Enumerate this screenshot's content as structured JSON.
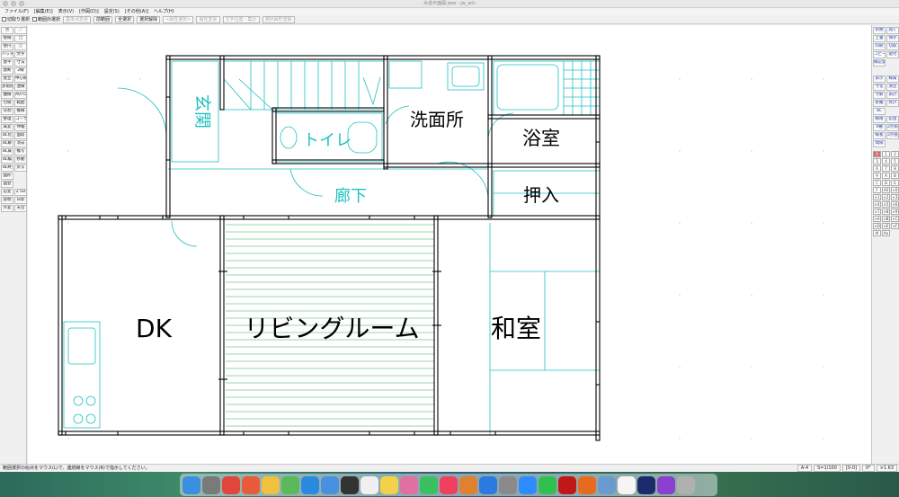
{
  "window": {
    "title": "木造平面図.jww - jw_win"
  },
  "menu": [
    "ファイル(F)",
    "[編集(E)]",
    "表示(V)",
    "[作図(D)]",
    "設定(S)",
    "[その他(A)]",
    "ヘルプ(H)"
  ],
  "toolbar": {
    "check1": "切取り選択",
    "check2": "範囲外選択",
    "btn_base": "基準点変更",
    "btn_prev": "前範囲",
    "btn_all": "全選択",
    "btn_deselect": "選択解除",
    "btn_attr": "<属性選択>",
    "btn_text": "属性変更",
    "btn_textpos": "文字位置・集計",
    "btn_select": "選択図形登録"
  },
  "left_tools": [
    "点",
    "／",
    "接線",
    "□",
    "接円",
    "○",
    "ハッチ",
    "文字",
    "建平",
    "寸法",
    "建断",
    "2線",
    "建立",
    "中心線",
    "多角形",
    "連線",
    "曲線",
    "AUTO",
    "包絡",
    "範囲",
    "分割",
    "複線",
    "整理",
    "コーナー",
    "属変",
    "伸縮",
    "BL化",
    "面取",
    "BL解",
    "消去",
    "BL属",
    "複写",
    "BL編",
    "移動",
    "BL終",
    "戻る",
    "図形",
    "",
    "図登",
    "",
    "記変",
    "2.5D",
    "座標",
    "日影",
    "外変",
    "天空"
  ],
  "right_tools": [
    "新規",
    "開く",
    "上書",
    "保存",
    "印刷",
    "切取",
    "コピー",
    "貼付",
    "線記変",
    "",
    "",
    "",
    "表示",
    "線属",
    "寸化",
    "測定",
    "寸解",
    "表計",
    "距離",
    "式計",
    "BL",
    "",
    "線角",
    "鉛直",
    "X軸",
    "2点角",
    "線長",
    "2点長",
    "間隔"
  ],
  "layers": [
    "0",
    "1",
    "2",
    "3",
    "4",
    "5",
    "6",
    "7",
    "8",
    "9",
    "A",
    "B",
    "C",
    "D",
    "E",
    "F",
    "All",
    "×0",
    "×1",
    "×2",
    "×3",
    "×4",
    "×5",
    "×6",
    "×7",
    "×8",
    "×9",
    "×A",
    "×B",
    "×C",
    "×D",
    "×E",
    "×F",
    "Al",
    "Aa"
  ],
  "rooms": {
    "genkan": "玄関",
    "toilet": "トイレ",
    "senmen": "洗面所",
    "yokushitsu": "浴室",
    "roka": "廊下",
    "oshiire": "押入",
    "dk": "DK",
    "living": "リビングルーム",
    "washitsu": "和室"
  },
  "status": {
    "message": "範囲選択の始点をマウス(L)で、連続線をマウス(R)で指示してください。",
    "paper": "A-4",
    "scale": "S=1/100",
    "layer": "[0-0]",
    "angle": "0°",
    "zoom": "×1.63"
  },
  "colors": {
    "wall": "#000000",
    "cyan": "#20c0c0",
    "green": "#30b050",
    "canvas": "#ffffff"
  },
  "dock_icons": [
    "finder-icon",
    "launchpad-icon",
    "chrome-icon",
    "calendar-icon",
    "notes-icon",
    "maps-icon",
    "safari-icon",
    "mail-icon",
    "clock-icon",
    "reminders-icon",
    "notes-icon",
    "photos-icon",
    "messages-icon",
    "music-icon",
    "books-icon",
    "appstore-icon",
    "preferences-icon",
    "zoom-icon",
    "line-icon",
    "acrobat-icon",
    "firefox-icon",
    "preview-icon",
    "textedit-icon",
    "jww-icon",
    "vpn-icon",
    "trash-icon"
  ]
}
